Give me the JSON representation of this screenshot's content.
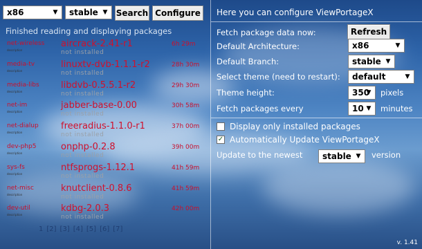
{
  "toolbar": {
    "arch_value": "x86",
    "branch_value": "stable",
    "search_label": "Search",
    "configure_label": "Configure"
  },
  "status_text": "Finished reading and displaying packages",
  "packages": [
    {
      "category": "net-wireless",
      "name": "aircrack-2.41-r1",
      "status": "not installed",
      "time": "6h 29m"
    },
    {
      "category": "media-tv",
      "name": "linuxtv-dvb-1.1.1-r2",
      "status": "not installed",
      "time": "28h 30m"
    },
    {
      "category": "media-libs",
      "name": "libdvb-0.5.5.1-r2",
      "status": "not installed",
      "time": "29h 30m"
    },
    {
      "category": "net-im",
      "name": "jabber-base-0.00",
      "status": "not installed",
      "time": "30h 58m"
    },
    {
      "category": "net-dialup",
      "name": "freeradius-1.1.0-r1",
      "status": "not installed",
      "time": "37h 00m"
    },
    {
      "category": "dev-php5",
      "name": "onphp-0.2.8",
      "status": "not installed",
      "time": "39h 00m"
    },
    {
      "category": "sys-fs",
      "name": "ntfsprogs-1.12.1",
      "status": "not installed",
      "time": "41h 59m"
    },
    {
      "category": "net-misc",
      "name": "knutclient-0.8.6",
      "status": "not installed",
      "time": "41h 59m"
    },
    {
      "category": "dev-util",
      "name": "kdbg-2.0.3",
      "status": "not installed",
      "time": "42h 00m"
    }
  ],
  "pager": [
    "1",
    "[2]",
    "[3]",
    "[4]",
    "[5]",
    "[6]",
    "[7]"
  ],
  "config": {
    "intro": "Here you can configure ViewPortageX",
    "fetch_label": "Fetch package data now:",
    "refresh_label": "Refresh",
    "arch_label": "Default Architecture:",
    "arch_value": "x86",
    "branch_label": "Default Branch:",
    "branch_value": "stable",
    "theme_label": "Select theme (need to restart):",
    "theme_value": "default",
    "height_label": "Theme height:",
    "height_value": "350",
    "height_unit": "pixels",
    "fetch_every_label": "Fetch packages every",
    "fetch_every_value": "10",
    "fetch_every_unit": "minutes",
    "display_installed_label": "Display only installed packages",
    "display_installed_checked": false,
    "auto_update_label": "Automatically Update ViewPortageX",
    "auto_update_checked": true,
    "update_to_label": "Update to the newest",
    "update_to_value": "stable",
    "update_to_unit": "version"
  },
  "version": "v. 1.41"
}
